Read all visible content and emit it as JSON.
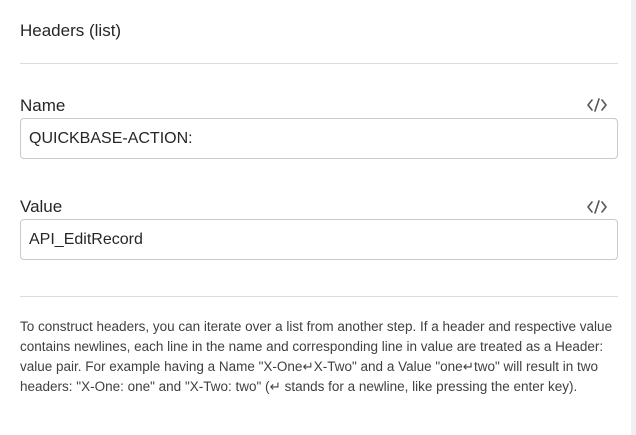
{
  "section": {
    "title": "Headers (list)"
  },
  "fields": {
    "name": {
      "label": "Name",
      "value": "QUICKBASE-ACTION:",
      "toggle_icon": "code-icon"
    },
    "value": {
      "label": "Value",
      "value": "API_EditRecord",
      "toggle_icon": "code-icon"
    }
  },
  "help": {
    "text": "To construct headers, you can iterate over a list from another step. If a header and respective value contains newlines, each line in the name and corresponding line in value are treated as a Header: value pair. For example having a Name \"X-One↵X-Two\" and a Value \"one↵two\" will result in two headers: \"X-One: one\" and \"X-Two: two\" (↵ stands for a newline, like pressing the enter key)."
  },
  "colors": {
    "border": "#c9c9cf",
    "divider": "#dcdce0",
    "text": "#262626",
    "icon": "#55555c"
  }
}
